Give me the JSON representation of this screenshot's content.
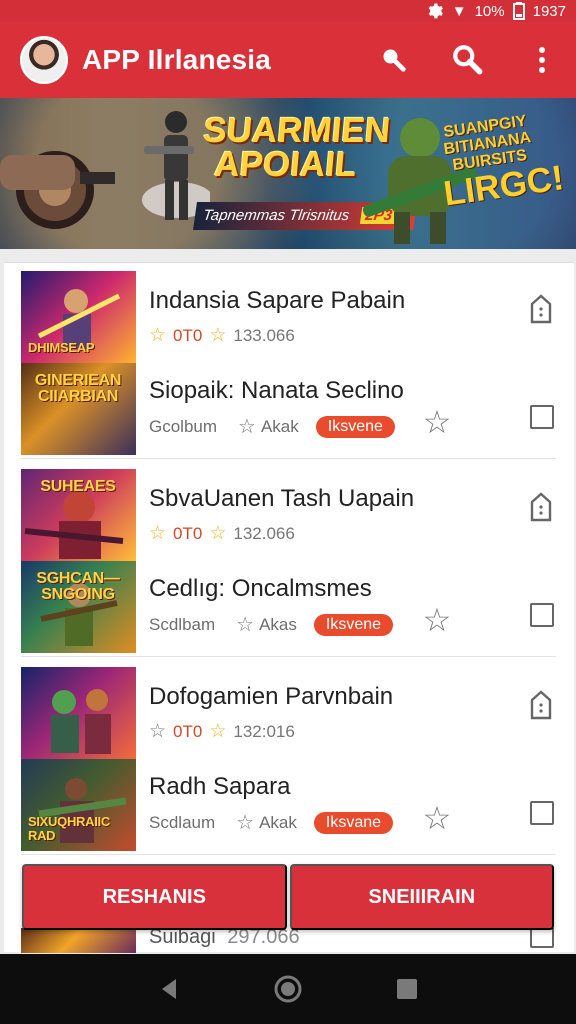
{
  "status": {
    "signal": "▼",
    "battery_percent": "10%",
    "time": "1937"
  },
  "app_bar": {
    "title": "APP Ilrlanesia"
  },
  "banner": {
    "title_line1": "SUARMIEN",
    "title_line2": "APOIAIL",
    "subtitle": "Tapnemmas Tlrisnitus",
    "subtitle_badge": "2P3",
    "side_top": "SUANPGIY BITIANANA BUIRSITS",
    "side_bottom": "LIRGC!"
  },
  "items": [
    {
      "title": "Indansia Sapare Pabain",
      "rating": "0T0",
      "downloads": "133.066",
      "thumb_label_top": "DHIMSEAP",
      "subtitle": "Siopaik: Nanata Seclino",
      "sub_label": "Gcolbum",
      "sub_label_2": "Akak",
      "badge": "Iksvene",
      "thumb_label_bottom": "GINERIEAN CIIARBIAN"
    },
    {
      "title": "SbvaUanen Tash Uapain",
      "rating": "0T0",
      "downloads": "132.066",
      "thumb_label_top": "SUHEAES",
      "subtitle": "Cedlıg: Oncalmsmes",
      "sub_label": "Scdlbam",
      "sub_label_2": "Akas",
      "badge": "Iksvene",
      "thumb_label_bottom": "SGHCAN— SNGOING"
    },
    {
      "title": "Dofogamien Parvnbain",
      "rating": "0T0",
      "downloads": "132:016",
      "thumb_label_top": "",
      "subtitle": "Radh Sapara",
      "sub_label": "Scdlaum",
      "sub_label_2": "Akak",
      "badge": "Iksvane",
      "thumb_label_bottom": "SIXUQHRAIIC RAD"
    }
  ],
  "peek": {
    "title": "Suibagi",
    "meta": "297.066"
  },
  "buttons": {
    "left": "RESHANIS",
    "right": "SNEIIIRAIN"
  },
  "colors": {
    "primary": "#d9303a",
    "badge": "#e84c2c",
    "rating": "#d24a27",
    "star": "#f3b326"
  }
}
